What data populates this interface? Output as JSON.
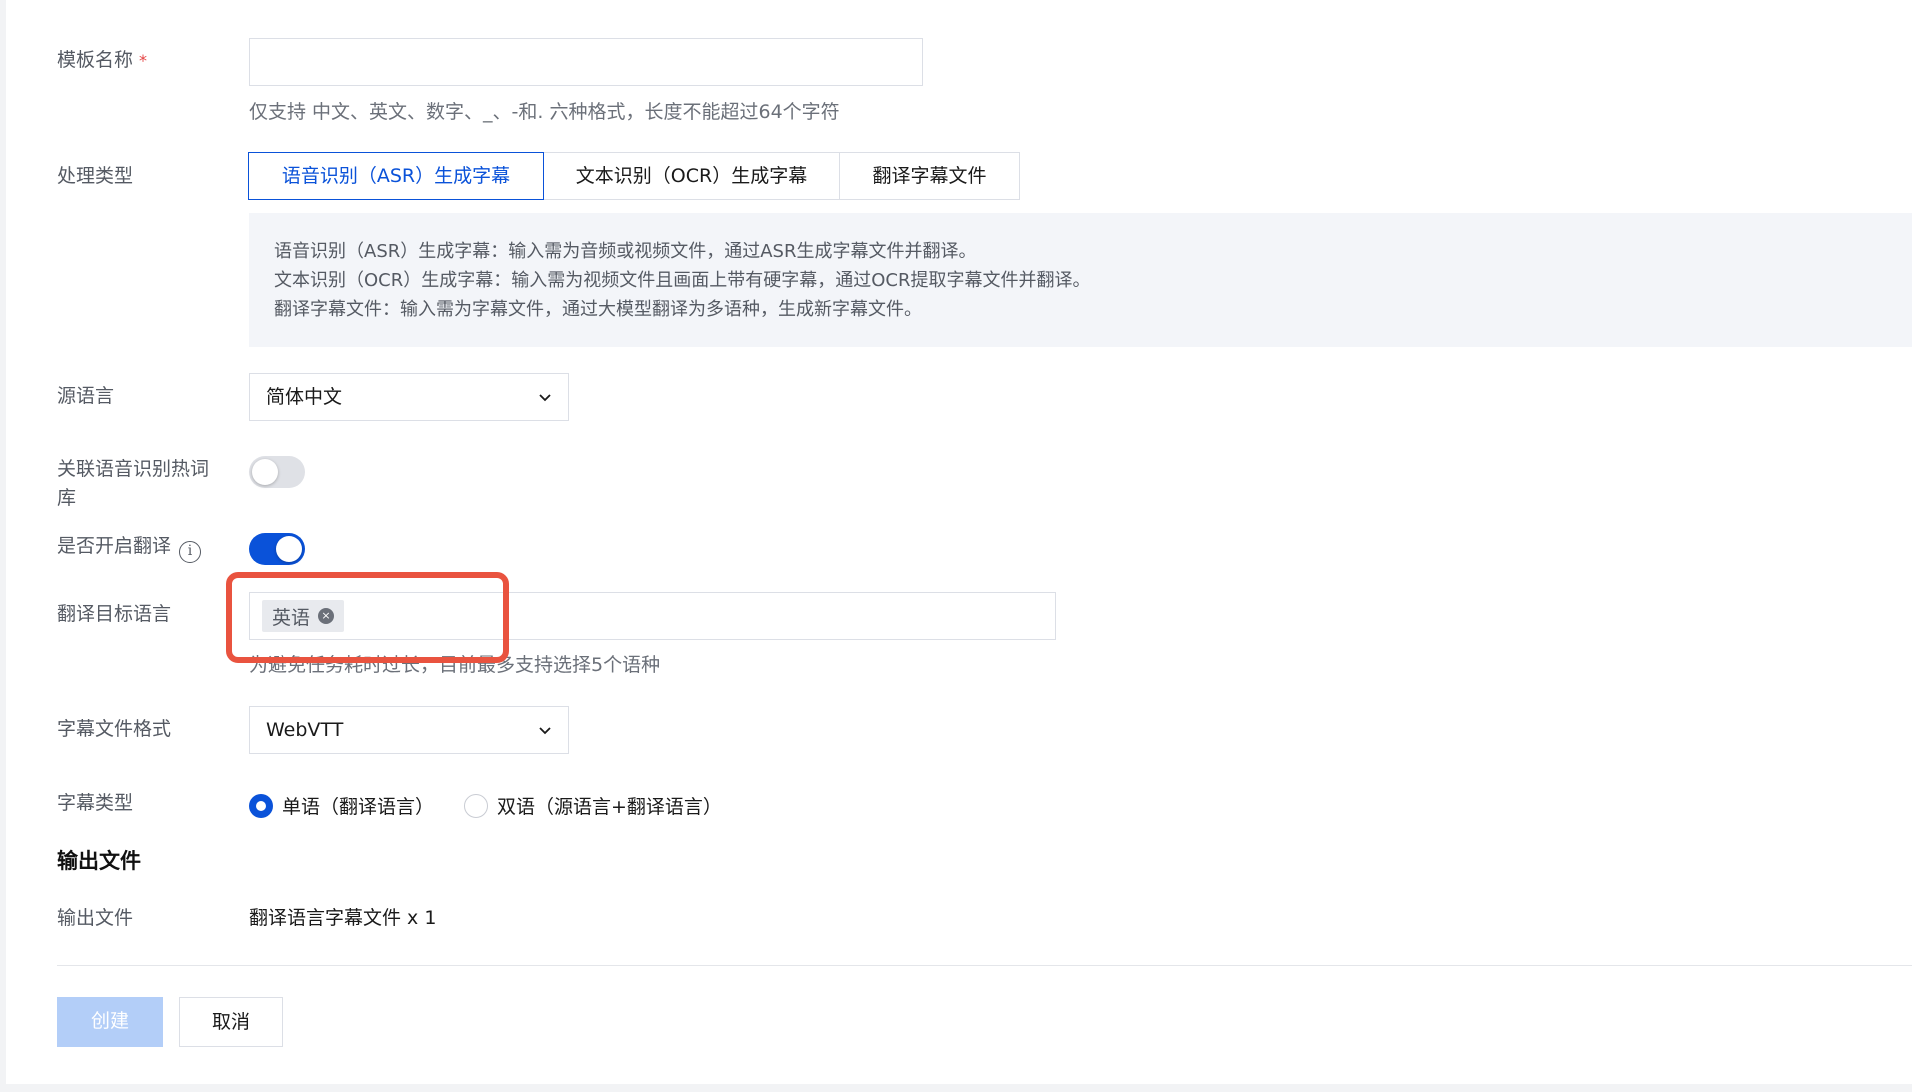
{
  "form": {
    "template_name": {
      "label": "模板名称",
      "required_mark": "*",
      "value": "",
      "hint": "仅支持 中文、英文、数字、_、-和. 六种格式，长度不能超过64个字符"
    },
    "process_type": {
      "label": "处理类型",
      "options": [
        "语音识别（ASR）生成字幕",
        "文本识别（OCR）生成字幕",
        "翻译字幕文件"
      ],
      "selected": "语音识别（ASR）生成字幕",
      "descriptions": [
        "语音识别（ASR）生成字幕：输入需为音频或视频文件，通过ASR生成字幕文件并翻译。",
        "文本识别（OCR）生成字幕：输入需为视频文件且画面上带有硬字幕，通过OCR提取字幕文件并翻译。",
        "翻译字幕文件：输入需为字幕文件，通过大模型翻译为多语种，生成新字幕文件。"
      ]
    },
    "source_language": {
      "label": "源语言",
      "value": "简体中文"
    },
    "hotword": {
      "label_line1": "关联语音识别热词",
      "label_line2": "库",
      "enabled": false
    },
    "translate": {
      "label": "是否开启翻译",
      "info_icon": "i",
      "enabled": true
    },
    "target_language": {
      "label": "翻译目标语言",
      "tags": [
        "英语"
      ],
      "remove_glyph": "×",
      "hint": "为避免任务耗时过长，目前最多支持选择5个语种"
    },
    "subtitle_format": {
      "label": "字幕文件格式",
      "value": "WebVTT"
    },
    "subtitle_type": {
      "label": "字幕类型",
      "options": [
        "单语（翻译语言）",
        "双语（源语言+翻译语言）"
      ],
      "selected": "单语（翻译语言）"
    }
  },
  "output": {
    "section_title": "输出文件",
    "label": "输出文件",
    "value": "翻译语言字幕文件 x 1"
  },
  "actions": {
    "create_label": "创建",
    "cancel_label": "取消"
  },
  "colors": {
    "accent": "#0a52d9",
    "highlight_box": "#e9533f",
    "required": "#e54545"
  }
}
